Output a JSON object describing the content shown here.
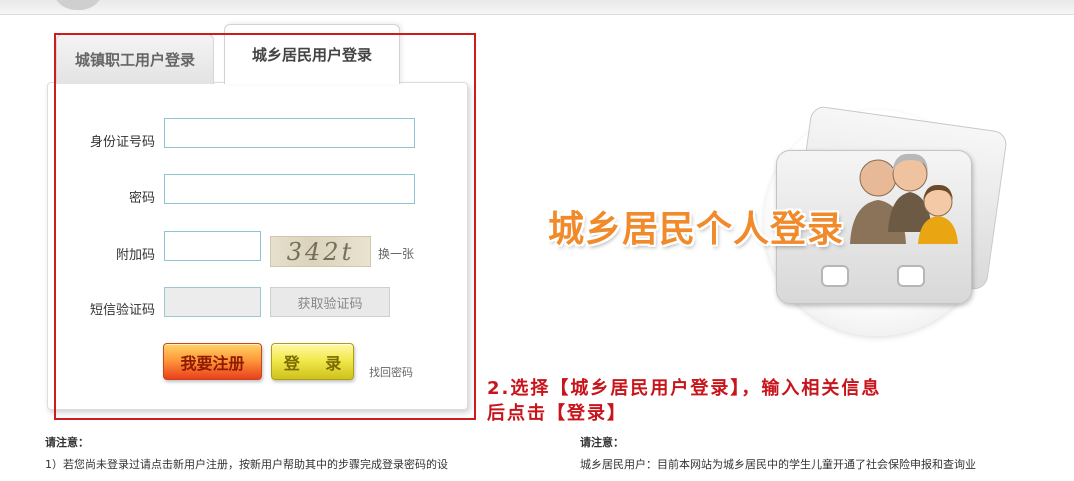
{
  "tabs": {
    "inactive": "城镇职工用户登录",
    "active": "城乡居民用户登录"
  },
  "form": {
    "id_label": "身份证号码",
    "password_label": "密码",
    "captcha_label": "附加码",
    "captcha_text": "342t",
    "captcha_refresh": "换一张",
    "sms_label": "短信验证码",
    "sms_button": "获取验证码",
    "register_button": "我要注册",
    "login_button": "登 录",
    "forgot_link": "找回密码"
  },
  "illustration": {
    "title": "城乡居民个人登录"
  },
  "annotation": {
    "line1": "2.选择【城乡居民用户登录】，输入相关信息",
    "line2": "后点击【登录】"
  },
  "notice_left": {
    "heading": "请注意：",
    "text": "1）若您尚未登录过请点击新用户注册，按新用户帮助其中的步骤完成登录密码的设"
  },
  "notice_right": {
    "heading": "请注意：",
    "text": "城乡居民用户：目前本网站为城乡居民中的学生儿童开通了社会保险申报和查询业"
  },
  "colors": {
    "annotation_red": "#c8141b",
    "highlight_border": "#cc1c1c",
    "title_orange": "#f08a2a",
    "input_border": "#8ec5d4"
  }
}
